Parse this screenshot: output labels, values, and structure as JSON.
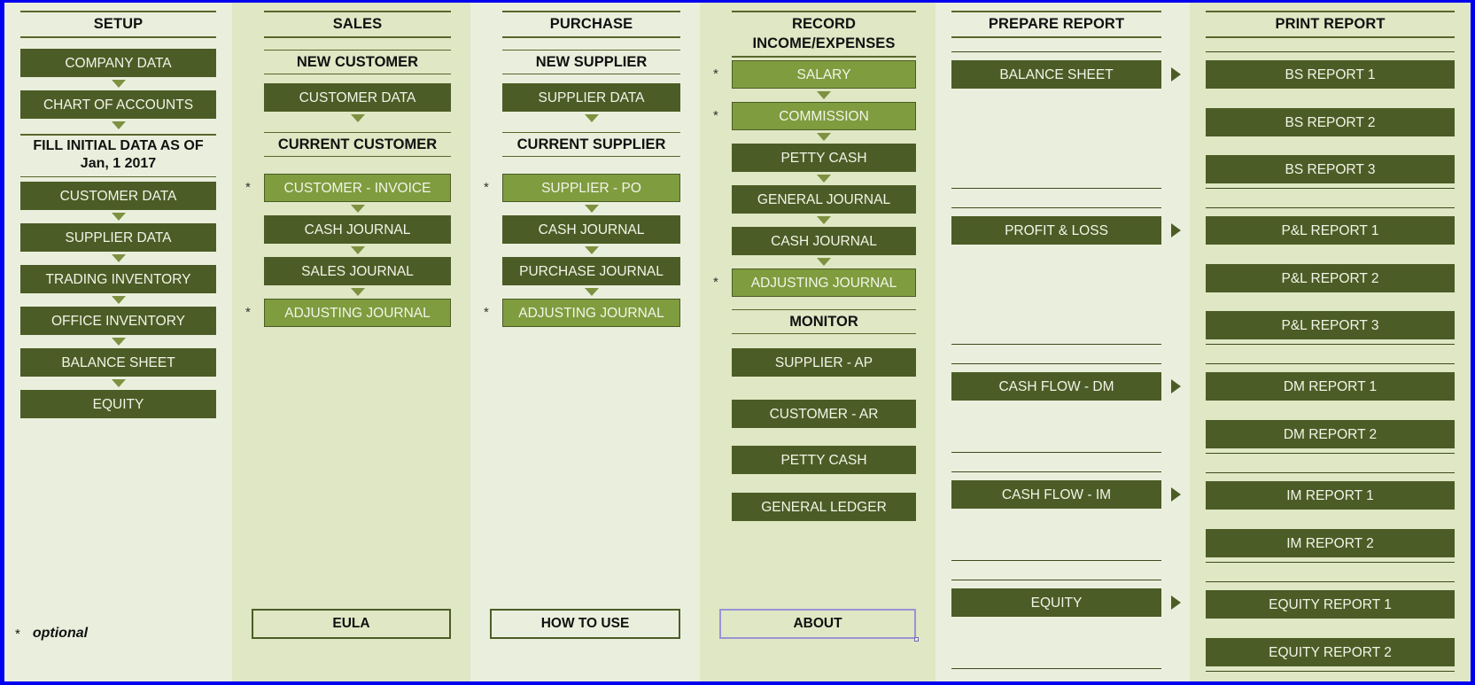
{
  "theme": {
    "outer_border": "#0000ee",
    "panel_bg": "#eaefdd",
    "panel_bg_alt": "#dfe7c4",
    "button_bg": "#4c5c26",
    "button_bg_optional": "#7f9c3f",
    "button_text": "#f2f5e8",
    "selected_border": "#9a93d4",
    "rule_color": "#59662c"
  },
  "legend": {
    "asterisk": "*",
    "label": "optional"
  },
  "columns": [
    {
      "id": "setup",
      "header": "SETUP",
      "items": [
        {
          "type": "button",
          "label": "COMPANY DATA",
          "optional": false,
          "arrow_after": true
        },
        {
          "type": "button",
          "label": "CHART OF ACCOUNTS",
          "optional": false,
          "arrow_after": true
        },
        {
          "type": "note",
          "label": "FILL INITIAL DATA AS OF\nJan, 1 2017"
        },
        {
          "type": "button",
          "label": "CUSTOMER DATA",
          "optional": false,
          "arrow_after": true
        },
        {
          "type": "button",
          "label": "SUPPLIER DATA",
          "optional": false,
          "arrow_after": true
        },
        {
          "type": "button",
          "label": "TRADING INVENTORY",
          "optional": false,
          "arrow_after": true
        },
        {
          "type": "button",
          "label": "OFFICE INVENTORY",
          "optional": false,
          "arrow_after": true
        },
        {
          "type": "button",
          "label": "BALANCE SHEET",
          "optional": false,
          "arrow_after": true
        },
        {
          "type": "button",
          "label": "EQUITY",
          "optional": false,
          "arrow_after": false
        }
      ],
      "bottom_button": null
    },
    {
      "id": "sales",
      "header": "SALES",
      "items": [
        {
          "type": "subheader",
          "label": "NEW CUSTOMER"
        },
        {
          "type": "button",
          "label": "CUSTOMER DATA",
          "optional": false,
          "arrow_after": true
        },
        {
          "type": "subheader",
          "label": "CURRENT CUSTOMER"
        },
        {
          "type": "button",
          "label": "CUSTOMER - INVOICE",
          "optional": true,
          "arrow_after": true
        },
        {
          "type": "button",
          "label": "CASH JOURNAL",
          "optional": false,
          "arrow_after": true
        },
        {
          "type": "button",
          "label": "SALES JOURNAL",
          "optional": false,
          "arrow_after": true
        },
        {
          "type": "button",
          "label": "ADJUSTING JOURNAL",
          "optional": true,
          "arrow_after": false
        }
      ],
      "bottom_button": {
        "label": "EULA",
        "selected": false
      }
    },
    {
      "id": "purchase",
      "header": "PURCHASE",
      "items": [
        {
          "type": "subheader",
          "label": "NEW SUPPLIER"
        },
        {
          "type": "button",
          "label": "SUPPLIER DATA",
          "optional": false,
          "arrow_after": true
        },
        {
          "type": "subheader",
          "label": "CURRENT SUPPLIER"
        },
        {
          "type": "button",
          "label": "SUPPLIER - PO",
          "optional": true,
          "arrow_after": true
        },
        {
          "type": "button",
          "label": "CASH JOURNAL",
          "optional": false,
          "arrow_after": true
        },
        {
          "type": "button",
          "label": "PURCHASE JOURNAL",
          "optional": false,
          "arrow_after": true
        },
        {
          "type": "button",
          "label": "ADJUSTING JOURNAL",
          "optional": true,
          "arrow_after": false
        }
      ],
      "bottom_button": {
        "label": "HOW TO USE",
        "selected": false
      }
    },
    {
      "id": "record-income-expenses",
      "header": "RECORD\nINCOME/EXPENSES",
      "items": [
        {
          "type": "button",
          "label": "SALARY",
          "optional": true,
          "arrow_after": true
        },
        {
          "type": "button",
          "label": "COMMISSION",
          "optional": true,
          "arrow_after": true
        },
        {
          "type": "button",
          "label": "PETTY CASH",
          "optional": false,
          "arrow_after": true
        },
        {
          "type": "button",
          "label": "GENERAL JOURNAL",
          "optional": false,
          "arrow_after": true
        },
        {
          "type": "button",
          "label": "CASH JOURNAL",
          "optional": false,
          "arrow_after": true
        },
        {
          "type": "button",
          "label": "ADJUSTING JOURNAL",
          "optional": true,
          "arrow_after": false
        },
        {
          "type": "subheader",
          "label": "MONITOR"
        },
        {
          "type": "button",
          "label": "SUPPLIER - AP",
          "optional": false,
          "arrow_after": false
        },
        {
          "type": "button",
          "label": "CUSTOMER - AR",
          "optional": false,
          "arrow_after": false
        },
        {
          "type": "button",
          "label": "PETTY CASH",
          "optional": false,
          "arrow_after": false
        },
        {
          "type": "button",
          "label": "GENERAL LEDGER",
          "optional": false,
          "arrow_after": false
        }
      ],
      "bottom_button": {
        "label": "ABOUT",
        "selected": true
      }
    }
  ],
  "report_section": {
    "prepare_header": "PREPARE REPORT",
    "print_header": "PRINT REPORT",
    "groups": [
      {
        "prepare": "BALANCE SHEET",
        "prints": [
          "BS REPORT 1",
          "BS REPORT 2",
          "BS REPORT 3"
        ]
      },
      {
        "prepare": "PROFIT & LOSS",
        "prints": [
          "P&L REPORT 1",
          "P&L REPORT 2",
          "P&L REPORT 3"
        ]
      },
      {
        "prepare": "CASH FLOW - DM",
        "prints": [
          "DM REPORT 1",
          "DM REPORT 2"
        ]
      },
      {
        "prepare": "CASH FLOW - IM",
        "prints": [
          "IM REPORT 1",
          "IM REPORT 2"
        ]
      },
      {
        "prepare": "EQUITY",
        "prints": [
          "EQUITY REPORT 1",
          "EQUITY REPORT 2"
        ]
      }
    ]
  }
}
